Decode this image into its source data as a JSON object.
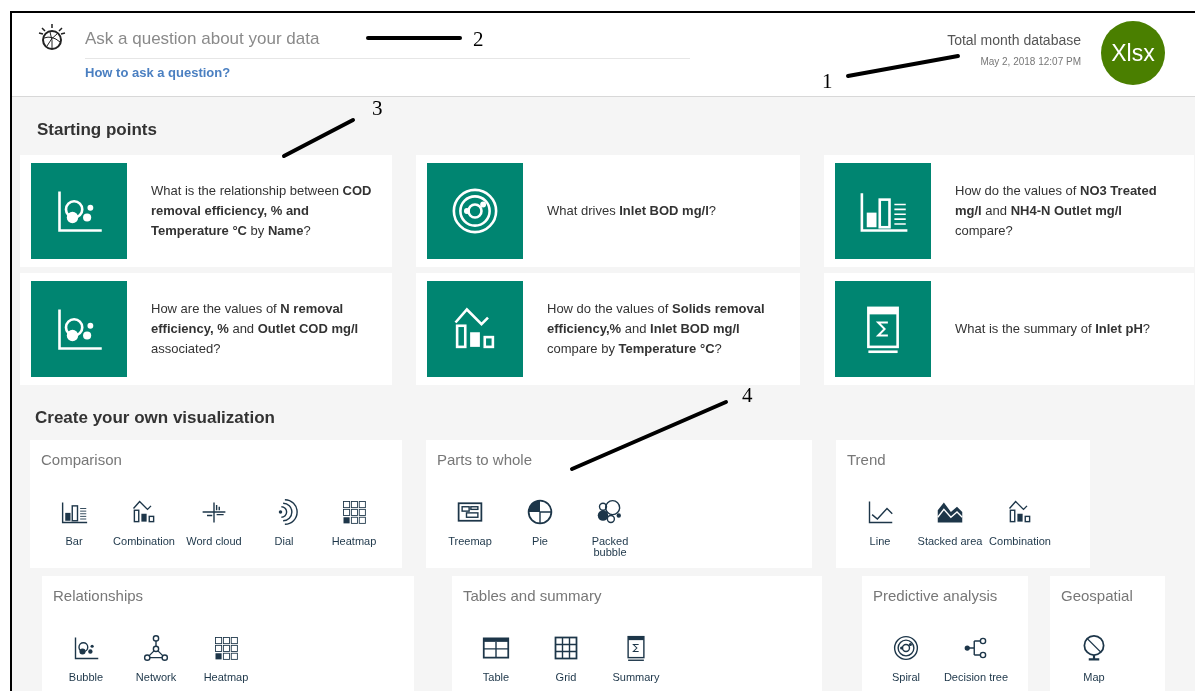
{
  "header": {
    "placeholder": "Ask a question about your data",
    "help_link": "How to ask a question?",
    "dataset_title": "Total month database",
    "dataset_date": "May 2, 2018 12:07 PM",
    "avatar": "Xlsx"
  },
  "starting_points": {
    "title": "Starting points",
    "cards": [
      {
        "kind": "bubble",
        "question": "What is the relationship between **COD removal efficiency, % and Temperature °C** by **Name**?"
      },
      {
        "kind": "radar",
        "question": "What drives **Inlet BOD mg/l**?"
      },
      {
        "kind": "bar",
        "question": "How do the values of **NO3 Treated mg/l** and **NH4-N Outlet mg/l** compare?"
      },
      {
        "kind": "bubble",
        "question": "How are the values of **N removal efficiency, %** and **Outlet COD mg/l** associated?"
      },
      {
        "kind": "combination",
        "question": "How do the values of **Solids removal efficiency,%** and **Inlet BOD mg/l** compare by **Temperature °C**?"
      },
      {
        "kind": "summary",
        "question": "What is the summary of **Inlet pH**?"
      }
    ]
  },
  "visualization": {
    "title": "Create your own visualization",
    "groups": [
      {
        "title": "Comparison",
        "items": [
          {
            "kind": "bar",
            "label": "Bar"
          },
          {
            "kind": "combination",
            "label": "Combination"
          },
          {
            "kind": "wordcloud",
            "label": "Word cloud"
          },
          {
            "kind": "dial",
            "label": "Dial"
          },
          {
            "kind": "heatmap",
            "label": "Heatmap"
          }
        ]
      },
      {
        "title": "Parts to whole",
        "items": [
          {
            "kind": "treemap",
            "label": "Treemap"
          },
          {
            "kind": "pie",
            "label": "Pie"
          },
          {
            "kind": "packed",
            "label": "Packed bubble"
          }
        ]
      },
      {
        "title": "Trend",
        "items": [
          {
            "kind": "line",
            "label": "Line"
          },
          {
            "kind": "area",
            "label": "Stacked area"
          },
          {
            "kind": "combination",
            "label": "Combination"
          }
        ]
      },
      {
        "title": "Relationships",
        "items": [
          {
            "kind": "bubble",
            "label": "Bubble"
          },
          {
            "kind": "network",
            "label": "Network"
          },
          {
            "kind": "heatmap",
            "label": "Heatmap"
          }
        ]
      },
      {
        "title": "Tables and summary",
        "items": [
          {
            "kind": "table",
            "label": "Table"
          },
          {
            "kind": "grid",
            "label": "Grid"
          },
          {
            "kind": "summary",
            "label": "Summary"
          }
        ]
      },
      {
        "title": "Predictive analysis",
        "items": [
          {
            "kind": "radar",
            "label": "Spiral"
          },
          {
            "kind": "tree",
            "label": "Decision tree"
          }
        ]
      },
      {
        "title": "Geospatial",
        "items": [
          {
            "kind": "map",
            "label": "Map"
          }
        ]
      }
    ]
  },
  "annotations": [
    {
      "number": "1"
    },
    {
      "number": "2"
    },
    {
      "number": "3"
    },
    {
      "number": "4"
    }
  ]
}
